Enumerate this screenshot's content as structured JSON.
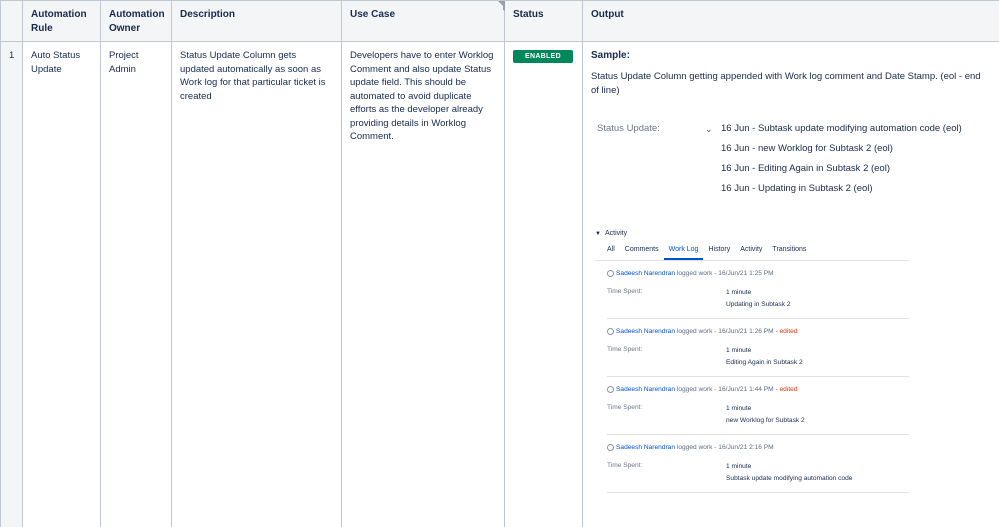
{
  "headers": {
    "rule": "Automation Rule",
    "owner": "Automation Owner",
    "description": "Description",
    "use_case": "Use Case",
    "status": "Status",
    "output": "Output"
  },
  "row": {
    "num": "1",
    "rule": "Auto Status Update",
    "owner": "Project Admin",
    "description": "Status Update Column gets updated automatically as soon as Work log for that particular ticket is created",
    "use_case": "Developers have to enter Worklog Comment and also update Status update field. This should be automated to avoid duplicate efforts as the developer already providing details in Worklog Comment.",
    "status": "ENABLED"
  },
  "output": {
    "sample_title": "Sample:",
    "sample_desc": "Status Update Column getting appended with Work log comment and Date Stamp. (eol - end of line)",
    "status_update_label": "Status Update:",
    "status_update_lines": [
      "16 Jun - Subtask update modifying automation code (eol)",
      "16 Jun - new Worklog for Subtask 2 (eol)",
      "16 Jun - Editing Again in Subtask 2 (eol)",
      "16 Jun - Updating in Subtask 2 (eol)"
    ]
  },
  "activity": {
    "title": "Activity",
    "tabs": [
      "All",
      "Comments",
      "Work Log",
      "History",
      "Activity",
      "Transitions"
    ],
    "active_tab": "Work Log",
    "entries": [
      {
        "user": "Sadeesh Narendran",
        "action": "logged work - 16/Jun/21 1:25 PM",
        "edited": "",
        "label": "Time Spent:",
        "time": "1 minute",
        "comment": "Updating in Subtask 2"
      },
      {
        "user": "Sadeesh Narendran",
        "action": "logged work - 16/Jun/21 1:26 PM -",
        "edited": "edited",
        "label": "Time Spent:",
        "time": "1 minute",
        "comment": "Editing Again in Subtask 2"
      },
      {
        "user": "Sadeesh Narendran",
        "action": "logged work - 16/Jun/21 1:44 PM -",
        "edited": "edited",
        "label": "Time Spent:",
        "time": "1 minute",
        "comment": "new Worklog for Subtask 2"
      },
      {
        "user": "Sadeesh Narendran",
        "action": "logged work - 16/Jun/21 2:16 PM",
        "edited": "",
        "label": "Time Spent:",
        "time": "1 minute",
        "comment": "Subtask update modifying automation code"
      }
    ]
  },
  "colors": {
    "enabled_badge": "#00875a",
    "link": "#0052cc",
    "edited": "#de350b",
    "header_bg": "#f4f5f7"
  }
}
